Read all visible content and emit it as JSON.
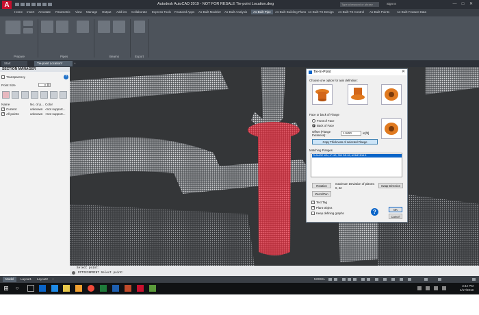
{
  "titlebar": {
    "app_logo": "A",
    "title": "Autodesk AutoCAD 2019 - NOT FOR RESALE    Tie-point Location.dwg",
    "search_placeholder": "Type a keyword or phrase",
    "signin": "Sign In",
    "controls": [
      "—",
      "□",
      "✕"
    ]
  },
  "ribbon_tabs": [
    "Home",
    "Insert",
    "Annotate",
    "Parametric",
    "View",
    "Manage",
    "Output",
    "Add-ins",
    "Collaborate",
    "Express Tools",
    "Featured Apps",
    "As-Built Modeler",
    "As-Built Analysis",
    "As-Built Pipe",
    "As-Built Building Plans",
    "As-Built TS Design",
    "As-Built TS Control",
    "As-Built Points",
    "As-Built Feature Data"
  ],
  "ribbon_active_tab": "As-Built Pipe",
  "ribbon_panels": [
    "Prepare",
    "Pipes",
    "Beams",
    "Export"
  ],
  "doc_tabs": [
    "Start",
    "Tie-point Location*"
  ],
  "section_manager": {
    "title": "SECTION MANAGER",
    "transparency_label": "Transparency",
    "point_size_label": "Point Size",
    "point_size_value": "2",
    "columns": [
      "Name",
      "No. of p...",
      "Color"
    ],
    "rows": [
      {
        "name": "Current",
        "count": "unknown",
        "color": "<not support..."
      },
      {
        "name": "All points",
        "count": "unknown",
        "color": "<not support..."
      }
    ]
  },
  "dialog": {
    "title": "Tie-In-Point",
    "choose_label": "Choose one option for axis definition:",
    "face_label": "Face or back of Flange",
    "front_label": "Front of Face",
    "back_label": "Back of Face",
    "offset_label": "Offset (Flange thickness):",
    "offset_value": "1.9450",
    "offset_unit": "in[ftl]",
    "copy_button": "Copy Thickness of selected Flange",
    "matching_label": "Matching Flanges",
    "matching_item": "FLANGE WN, 4\" NS, 300 DE-99, ASME B16.5",
    "rotation_button": "Rotation",
    "max_dev_label": "maximum Deviation of planes:",
    "max_dev_value": "0, 42",
    "swap_button": "Swap Direction",
    "zoom_button": "Zoom/Pan",
    "text_tag_label": "Text Tag",
    "plant_object_label": "Plant Object",
    "keep_graphs_label": "Keep defining graphs",
    "ok_button": "OK",
    "cancel_button": "Cancel",
    "help_icon": "?"
  },
  "command": {
    "history": "Select point:",
    "prompt": "PCTIEINPOINT Select point:"
  },
  "layout_tabs": [
    "Model",
    "Layout1",
    "Layout2"
  ],
  "status": {
    "model_label": "MODEL"
  },
  "taskbar": {
    "time": "3:42 PM",
    "date": "4/17/2018"
  },
  "colors": {
    "flange_red": "#d9606e",
    "accent_blue": "#0a64c8",
    "autocad_red": "#c8102e"
  }
}
